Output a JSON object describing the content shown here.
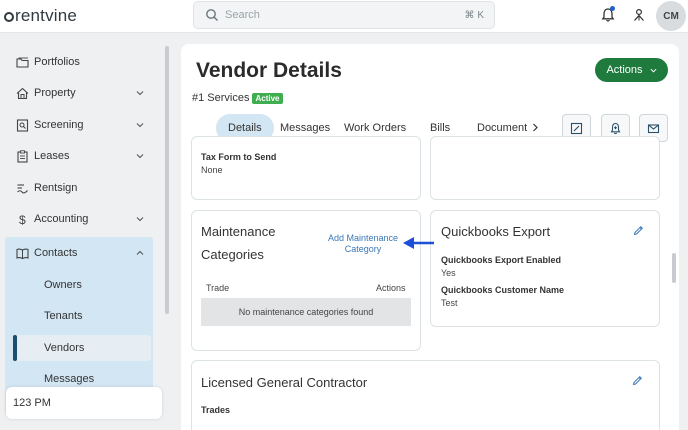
{
  "app": {
    "logo_text": "rentvine",
    "search_placeholder": "Search",
    "search_shortcut": "⌘ K",
    "avatar_initials": "CM"
  },
  "sidebar": {
    "items": [
      {
        "label": "Portfolios",
        "icon": "folder-icon"
      },
      {
        "label": "Property",
        "icon": "house-icon",
        "expandable": true
      },
      {
        "label": "Screening",
        "icon": "screening-icon",
        "expandable": true
      },
      {
        "label": "Leases",
        "icon": "clipboard-icon",
        "expandable": true
      },
      {
        "label": "Rentsign",
        "icon": "signature-icon"
      },
      {
        "label": "Accounting",
        "icon": "dollar-icon",
        "expandable": true
      },
      {
        "label": "Contacts",
        "icon": "book-icon",
        "expanded": true
      }
    ],
    "contacts_subitems": [
      "Owners",
      "Tenants",
      "Vendors",
      "Messages"
    ],
    "active_subitem": "Vendors",
    "time_box": "123 PM"
  },
  "page": {
    "title": "Vendor Details",
    "actions_label": "Actions",
    "vendor_name": "#1 Services",
    "status_badge": "Active",
    "tabs": [
      "Details",
      "Messages",
      "Work Orders",
      "Bills",
      "Document"
    ],
    "active_tab": "Details"
  },
  "tax_card": {
    "label": "Tax Form to Send",
    "value": "None"
  },
  "maintenance_card": {
    "title_line1": "Maintenance",
    "title_line2": "Categories",
    "add_link_line1": "Add Maintenance",
    "add_link_line2": "Category",
    "col_trade": "Trade",
    "col_actions": "Actions",
    "empty_text": "No maintenance categories found"
  },
  "quickbooks_card": {
    "title": "Quickbooks Export",
    "field1_label": "Quickbooks Export Enabled",
    "field1_value": "Yes",
    "field2_label": "Quickbooks Customer Name",
    "field2_value": "Test"
  },
  "contractor_card": {
    "title": "Licensed General Contractor",
    "field_label": "Trades"
  },
  "colors": {
    "accent_green": "#1f7a3e",
    "badge_green": "#3fae4f",
    "highlight_blue": "#d3e6f3",
    "link_blue": "#3b78b5",
    "arrow_blue": "#1d4fd8"
  }
}
